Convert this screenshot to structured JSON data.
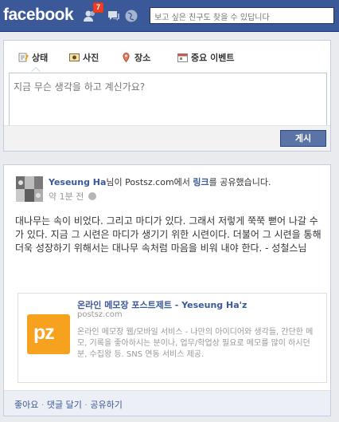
{
  "topbar": {
    "logo": "facebook",
    "notification_count": "7",
    "search_placeholder": "보고 싶은 친구도 찾을 수 있답니다"
  },
  "composer": {
    "tabs": [
      "상태",
      "사진",
      "장소",
      "중요 이벤트"
    ],
    "placeholder": "지금 무슨 생각을 하고 계신가요?",
    "post_label": "게시"
  },
  "story": {
    "author": "Yeseung Ha",
    "headline_mid": "님이 Postsz.com에서 ",
    "headline_link": "링크",
    "headline_end": "를 공유했습니다.",
    "time": "약 1분 전",
    "message": "대나무는 속이 비었다. 그리고 마디가 있다. 그래서 저렇게 쭉쭉 뻗어 나갈 수가 있다. 지금 그 시련은 마디가 생기기 위한 시련이다. 더불어 그 시련을 통해 더욱 성장하기 위해서는 대나무 속처럼 마음을 비워 내야 한다. - 성철스님",
    "attachment": {
      "logo_text": "pz",
      "title": "온라인 메모장 포스트제트 - Yeseung  Ha'z",
      "domain": "postsz.com",
      "description": "온라인 메모장 웹/모바일 서비스 - 나만의 아이디어와 생각들, 간단한 메모, 기록을 좋아하시는 분이나, 업무/학업상 필요로 메모를 많이 하시던 분, 수집왕 등. SNS 연동 서비스 제공."
    },
    "actions": {
      "like": "좋아요",
      "comment": "댓글 달기",
      "share": "공유하기",
      "separator": " · "
    }
  }
}
